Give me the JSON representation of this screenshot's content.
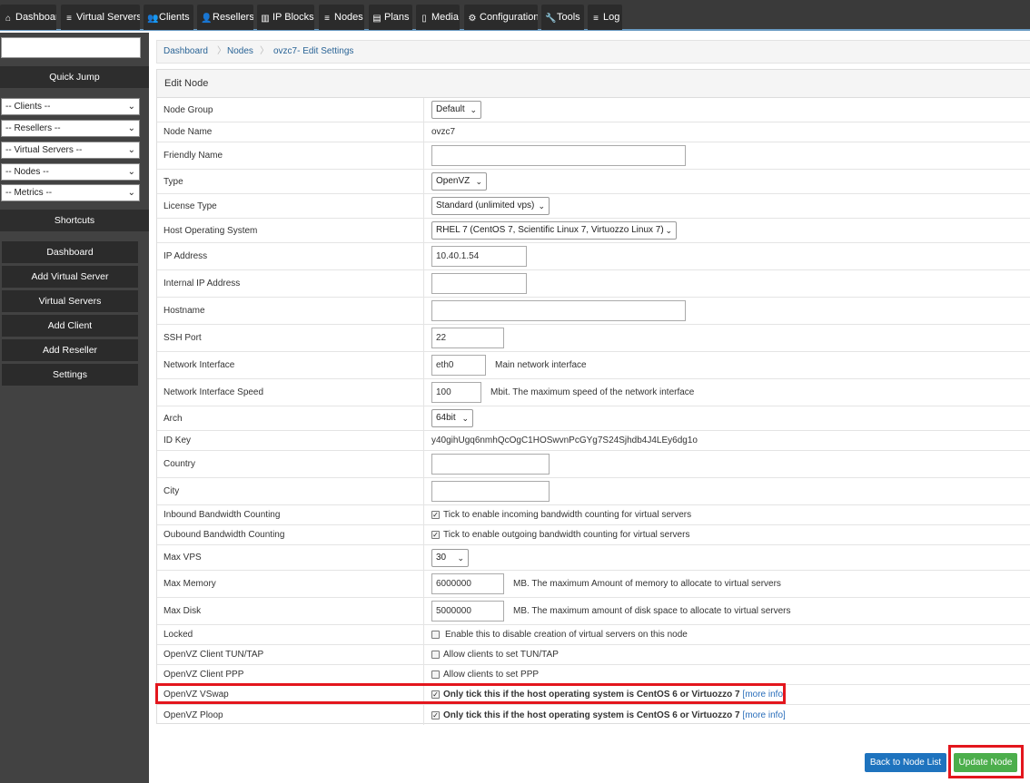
{
  "nav": [
    {
      "label": "Dashboard",
      "icon": "home-icon",
      "glyph": "⌂"
    },
    {
      "label": "Virtual Servers",
      "icon": "list-icon",
      "glyph": "≡"
    },
    {
      "label": "Clients",
      "icon": "users-icon",
      "glyph": "👥"
    },
    {
      "label": "Resellers",
      "icon": "user-icon",
      "glyph": "👤"
    },
    {
      "label": "IP Blocks",
      "icon": "columns-icon",
      "glyph": "▥"
    },
    {
      "label": "Nodes",
      "icon": "list-icon",
      "glyph": "≡"
    },
    {
      "label": "Plans",
      "icon": "server-icon",
      "glyph": "▤"
    },
    {
      "label": "Media",
      "icon": "file-icon",
      "glyph": "▯"
    },
    {
      "label": "Configuration",
      "icon": "gear-icon",
      "glyph": "⚙"
    },
    {
      "label": "Tools",
      "icon": "wrench-icon",
      "glyph": "🔧"
    },
    {
      "label": "Log",
      "icon": "list-icon",
      "glyph": "≡"
    }
  ],
  "sidebar": {
    "search_value": "",
    "quick_jump": "Quick Jump",
    "selects": [
      "-- Clients --",
      "-- Resellers --",
      "-- Virtual Servers --",
      "-- Nodes --",
      "-- Metrics --"
    ],
    "shortcuts_title": "Shortcuts",
    "shortcuts": [
      "Dashboard",
      "Add Virtual Server",
      "Virtual Servers",
      "Add Client",
      "Add Reseller",
      "Settings"
    ]
  },
  "breadcrumb": [
    "Dashboard",
    "Nodes",
    "ovzc7- Edit Settings"
  ],
  "panel_title": "Edit Node",
  "fields": {
    "node_group": {
      "label": "Node Group",
      "value": "Default"
    },
    "node_name": {
      "label": "Node Name",
      "value": "ovzc7"
    },
    "friendly_name": {
      "label": "Friendly Name",
      "value": ""
    },
    "type": {
      "label": "Type",
      "value": "OpenVZ"
    },
    "license_type": {
      "label": "License Type",
      "value": "Standard (unlimited vps)"
    },
    "host_os": {
      "label": "Host Operating System",
      "value": "RHEL 7 (CentOS 7, Scientific Linux 7, Virtuozzo Linux 7)"
    },
    "ip_address": {
      "label": "IP Address",
      "value": "10.40.1.54"
    },
    "internal_ip": {
      "label": "Internal IP Address",
      "value": ""
    },
    "hostname": {
      "label": "Hostname",
      "value": ""
    },
    "ssh_port": {
      "label": "SSH Port",
      "value": "22"
    },
    "net_iface": {
      "label": "Network Interface",
      "value": "eth0",
      "hint": "Main network interface"
    },
    "net_speed": {
      "label": "Network Interface Speed",
      "value": "100",
      "hint": "Mbit. The maximum speed of the network interface"
    },
    "arch": {
      "label": "Arch",
      "value": "64bit"
    },
    "id_key": {
      "label": "ID Key",
      "value": "y40gihUgq6nmhQcOgC1HOSwvnPcGYg7S24Sjhdb4J4LEy6dg1o"
    },
    "country": {
      "label": "Country",
      "value": ""
    },
    "city": {
      "label": "City",
      "value": ""
    },
    "inbound_bw": {
      "label": "Inbound Bandwidth Counting",
      "checked": true,
      "text": "Tick to enable incoming bandwidth counting for virtual servers"
    },
    "outbound_bw": {
      "label": "Oubound Bandwidth Counting",
      "checked": true,
      "text": "Tick to enable outgoing bandwidth counting for virtual servers"
    },
    "max_vps": {
      "label": "Max VPS",
      "value": "30"
    },
    "max_memory": {
      "label": "Max Memory",
      "value": "6000000",
      "hint": "MB. The maximum Amount of memory to allocate to virtual servers"
    },
    "max_disk": {
      "label": "Max Disk",
      "value": "5000000",
      "hint": "MB. The maximum amount of disk space to allocate to virtual servers"
    },
    "locked": {
      "label": "Locked",
      "checked": false,
      "text": "Enable this to disable creation of virtual servers on this node"
    },
    "tun_tap": {
      "label": "OpenVZ Client TUN/TAP",
      "checked": false,
      "text": "Allow clients to set TUN/TAP"
    },
    "ppp": {
      "label": "OpenVZ Client PPP",
      "checked": false,
      "text": "Allow clients to set PPP"
    },
    "vswap": {
      "label": "OpenVZ VSwap",
      "checked": true,
      "text": "Only tick this if the host operating system is CentOS 6 or Virtuozzo 7",
      "more": "[more info]"
    },
    "ploop": {
      "label": "OpenVZ Ploop",
      "checked": true,
      "text": "Only tick this if the host operating system is CentOS 6 or Virtuozzo 7",
      "more": "[more info]"
    }
  },
  "buttons": {
    "back": "Back to Node List",
    "update": "Update Node"
  },
  "colors": {
    "nav_bg": "#3a3a3a",
    "sidebar_bg": "#424242",
    "back_btn": "#1e73be",
    "update_btn": "#4cae4c",
    "highlight": "#e3161d"
  }
}
